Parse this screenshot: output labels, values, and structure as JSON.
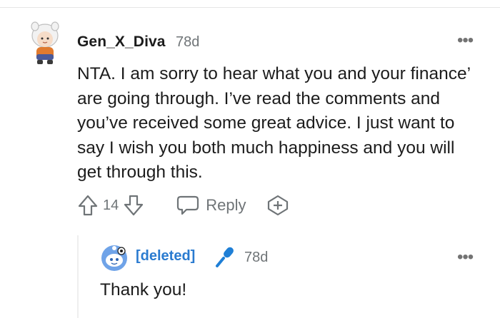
{
  "comment": {
    "author": "Gen_X_Diva",
    "age": "78d",
    "more": "•••",
    "body": "NTA. I am sorry to hear what you and your finance’ are going through. I’ve read the comments and you’ve received some great advice. I just want to say I wish you both much happiness and you will get through this.",
    "score": "14",
    "reply_label": "Reply",
    "icons": [
      "avatar-icon",
      "upvote-icon",
      "downvote-icon",
      "reply-icon",
      "award-icon",
      "more-icon"
    ]
  },
  "reply": {
    "author": "[deleted]",
    "age": "78d",
    "more": "•••",
    "body": "Thank you!",
    "icons": [
      "deleted-avatar-icon",
      "microphone-icon",
      "more-icon"
    ]
  },
  "colors": {
    "text": "#1c1c1c",
    "meta": "#6f7477",
    "deleted_user": "#2a7bd0"
  }
}
